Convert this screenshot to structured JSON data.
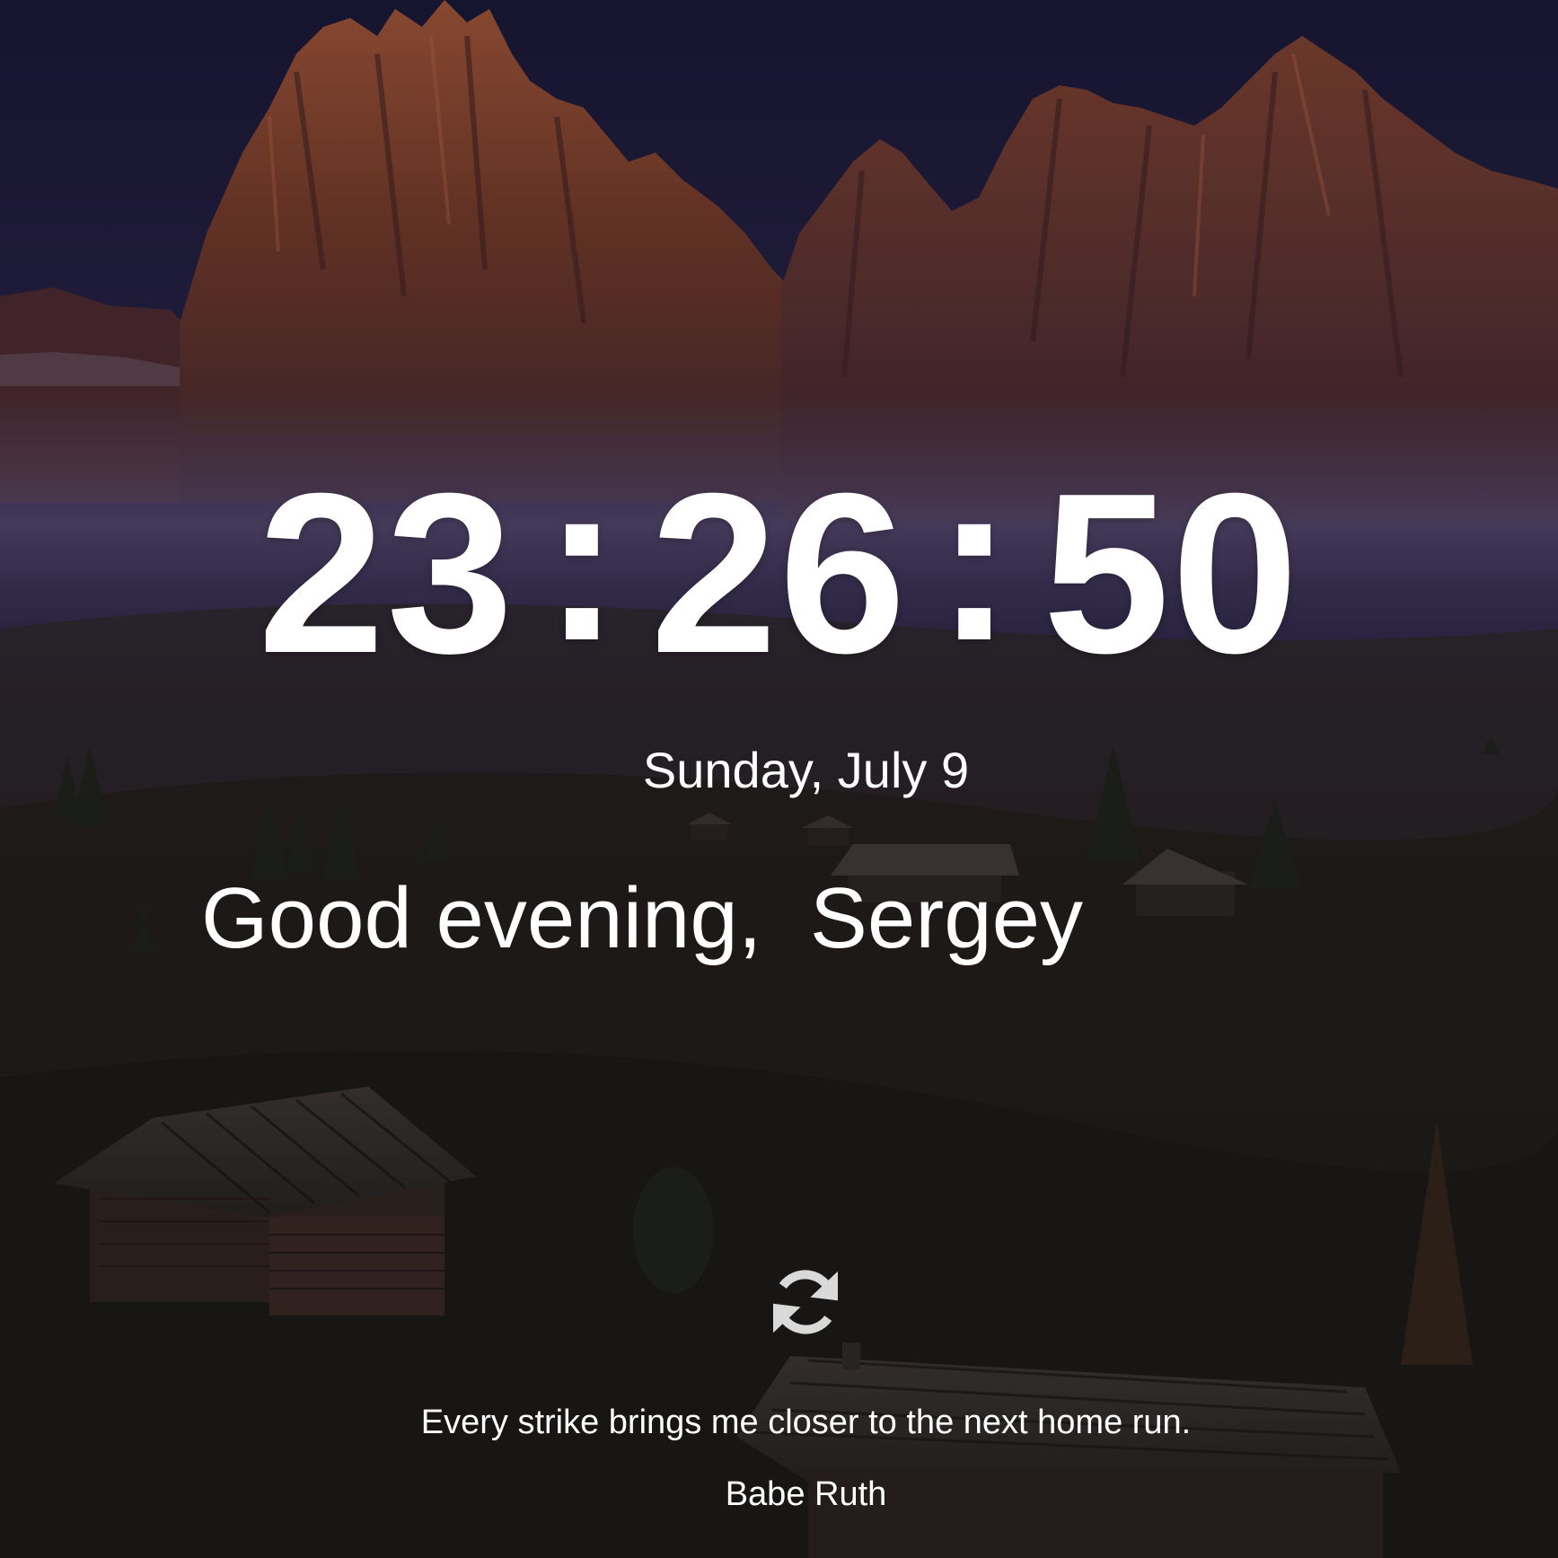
{
  "clock": {
    "hours": "23",
    "minutes": "26",
    "seconds": "50",
    "separator": ":"
  },
  "date": "Sunday, July 9",
  "greeting": {
    "text": "Good evening,  Sergey"
  },
  "refresh": {
    "icon": "refresh-icon"
  },
  "quote": {
    "text": "Every strike brings me closer to the next home run.",
    "author": "Babe Ruth"
  },
  "colors": {
    "text": "#ffffff",
    "sky": "#1d1b3f",
    "mountain": "#7b3e2c",
    "meadow": "#23201e"
  },
  "background": {
    "icon": "mountain-landscape-image"
  }
}
